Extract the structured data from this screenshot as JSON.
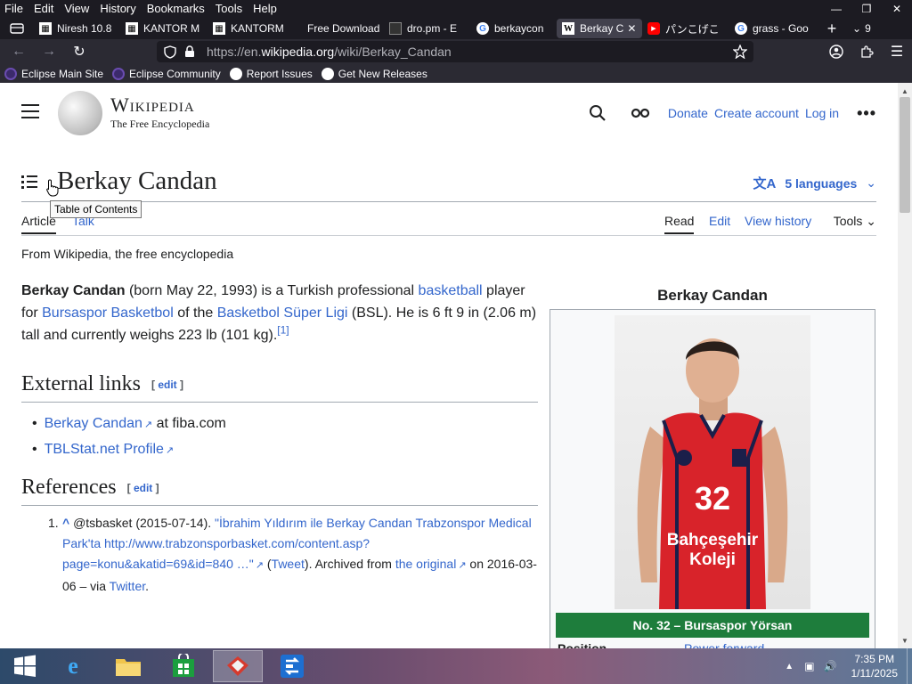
{
  "menubar": {
    "items": [
      "File",
      "Edit",
      "View",
      "History",
      "Bookmarks",
      "Tools",
      "Help"
    ]
  },
  "tabs": [
    {
      "label": "Niresh 10.8",
      "icon": "page-icon"
    },
    {
      "label": "KANTOR M",
      "icon": "page-icon"
    },
    {
      "label": "KANTORM",
      "icon": "page-icon"
    },
    {
      "label": "Free Download",
      "icon": "none"
    },
    {
      "label": "dro.pm - E",
      "icon": "terminal-icon"
    },
    {
      "label": "berkaycon",
      "icon": "google-icon"
    },
    {
      "label": "Berkay C",
      "icon": "wikipedia-icon",
      "active": true
    },
    {
      "label": "パンこげこ",
      "icon": "youtube-icon"
    },
    {
      "label": "grass - Goo",
      "icon": "google-icon"
    }
  ],
  "tab_overflow_count": "9",
  "urlbar": {
    "prefix": "https://en.",
    "domain": "wikipedia.org",
    "path": "/wiki/Berkay_Candan"
  },
  "bookmarks": [
    {
      "label": "Eclipse Main Site",
      "color": "#3b2a6b"
    },
    {
      "label": "Eclipse Community",
      "color": "#3b2a6b"
    },
    {
      "label": "Report Issues",
      "color": "#ffffff"
    },
    {
      "label": "Get New Releases",
      "color": "#ffffff"
    }
  ],
  "wiki": {
    "wordmark": "Wikipedia",
    "tagline_logo": "The Free Encyclopedia",
    "header_links": [
      "Donate",
      "Create account",
      "Log in"
    ],
    "title": "Berkay Candan",
    "languages": "5 languages",
    "tooltip": "Table of Contents",
    "tabs_left": [
      "Article",
      "Talk"
    ],
    "tabs_right": [
      "Read",
      "Edit",
      "View history"
    ],
    "tools": "Tools",
    "tagline": "From Wikipedia, the free encyclopedia",
    "intro": {
      "bold_name": "Berkay Candan",
      "t1": " (born May 22, 1993) is a Turkish professional ",
      "l1": "basketball",
      "t2": " player for ",
      "l2": "Bursaspor Basketbol",
      "t3": " of the ",
      "l3": "Basketbol Süper Ligi",
      "t4": " (BSL). He is 6 ft 9 in (2.06 m) tall and currently weighs 223 lb (101 kg).",
      "ref": "[1]"
    },
    "external_links": {
      "heading": "External links",
      "edit": "edit",
      "items": [
        {
          "link": "Berkay Candan",
          "suffix": " at fiba.com"
        },
        {
          "link": "TBLStat.net Profile",
          "suffix": ""
        }
      ]
    },
    "references": {
      "heading": "References",
      "edit": "edit",
      "num": "1.",
      "caret": "^",
      "author": " @tsbasket (2015-07-14). ",
      "title_link": "\"İbrahim Yıldırım ile Berkay Candan Trabzonspor Medical Park'ta http://www.trabzonsporbasket.com/content.asp?page=konu&akatid=69&id=840 …\"",
      "paren_open": " (",
      "tweet": "Tweet",
      "archived": "). Archived from ",
      "original": "the original",
      "on": " on 2016-03-06 – via ",
      "twitter": "Twitter",
      "period": "."
    },
    "infobox": {
      "title": "Berkay Candan",
      "caption": "No. 32 – Bursaspor Yörsan",
      "jersey_text1": "Bahçeşehir",
      "jersey_text2": "Koleji",
      "jersey_number": "32",
      "row_label": "Position",
      "row_value": "Power forward"
    }
  },
  "taskbar": {
    "time": "7:35 PM",
    "date": "1/11/2025"
  },
  "colors": {
    "link": "#3366cc",
    "caption_bg": "#1e7d3c",
    "jersey": "#d8232a"
  }
}
